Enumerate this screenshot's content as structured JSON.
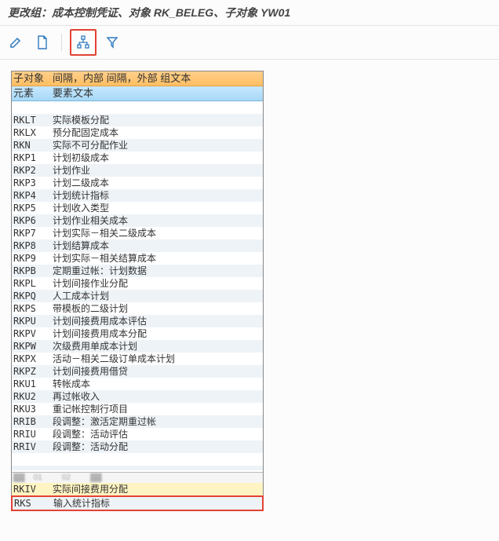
{
  "title": "更改组：成本控制凭证、对象 RK_BELEG、子对象 YW01",
  "toolbar": {
    "edit_icon": "edit-icon",
    "new_icon": "new-page-icon",
    "hierarchy_icon": "hierarchy-icon",
    "filter_icon": "filter-icon"
  },
  "panel": {
    "header_orange": {
      "c1": "子对象",
      "c2": "间隔，内部  间隔，外部  组文本"
    },
    "header_blue": {
      "c1": "元素",
      "c2": "要素文本"
    },
    "rows": [
      {
        "code": "RKLT",
        "text": "实际模板分配"
      },
      {
        "code": "RKLX",
        "text": "预分配固定成本"
      },
      {
        "code": "RKN",
        "text": "实际不可分配作业"
      },
      {
        "code": "RKP1",
        "text": "计划初级成本"
      },
      {
        "code": "RKP2",
        "text": "计划作业"
      },
      {
        "code": "RKP3",
        "text": "计划二级成本"
      },
      {
        "code": "RKP4",
        "text": "计划统计指标"
      },
      {
        "code": "RKP5",
        "text": "计划收入类型"
      },
      {
        "code": "RKP6",
        "text": "计划作业相关成本"
      },
      {
        "code": "RKP7",
        "text": "计划实际－相关二级成本"
      },
      {
        "code": "RKP8",
        "text": "计划结算成本"
      },
      {
        "code": "RKP9",
        "text": "计划实际－相关结算成本"
      },
      {
        "code": "RKPB",
        "text": "定期重过帐：计划数据"
      },
      {
        "code": "RKPL",
        "text": "计划间接作业分配"
      },
      {
        "code": "RKPQ",
        "text": "人工成本计划"
      },
      {
        "code": "RKPS",
        "text": "带模板的二级计划"
      },
      {
        "code": "RKPU",
        "text": "计划间接费用成本评估"
      },
      {
        "code": "RKPV",
        "text": "计划间接费用成本分配"
      },
      {
        "code": "RKPW",
        "text": "次级费用单成本计划"
      },
      {
        "code": "RKPX",
        "text": "活动－相关二级订单成本计划"
      },
      {
        "code": "RKPZ",
        "text": "计划间接费用借贷"
      },
      {
        "code": "RKU1",
        "text": "转帐成本"
      },
      {
        "code": "RKU2",
        "text": "再过帐收入"
      },
      {
        "code": "RKU3",
        "text": "重记帐控制行项目"
      },
      {
        "code": "RRIB",
        "text": "段调整：激活定期重过帐"
      },
      {
        "code": "RRIU",
        "text": "段调整：活动评估"
      },
      {
        "code": "RRIV",
        "text": "段调整：活动分配"
      }
    ],
    "scroll_hint": "▓▓    01         02         ▓▓",
    "row_after_scroll": {
      "code": "RKIV",
      "text": "实际间接费用分配"
    },
    "highlight_row": {
      "code": "RKS",
      "text": "输入统计指标"
    }
  }
}
